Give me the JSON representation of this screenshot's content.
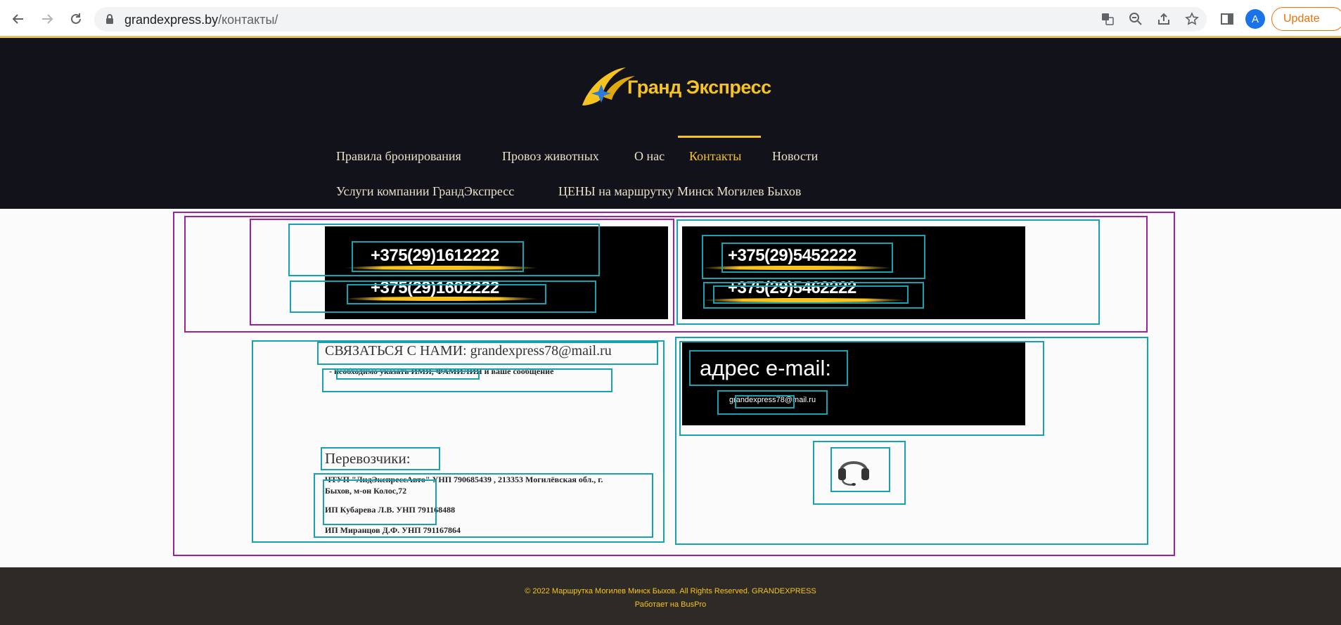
{
  "browser": {
    "url_domain": "grandexpress.by",
    "url_path": "/контакты/",
    "profile_initial": "A",
    "update_label": "Update"
  },
  "site": {
    "logo_text": "Гранд Экспресс",
    "nav": [
      {
        "label": "Правила бронирования"
      },
      {
        "label": "Провоз животных"
      },
      {
        "label": "О нас"
      },
      {
        "label": "Контакты"
      },
      {
        "label": "Новости"
      },
      {
        "label": "Услуги компании ГрандЭкспресс"
      },
      {
        "label": "ЦЕНЫ на маршрутку Минск Могилев Быхов"
      }
    ]
  },
  "phones": {
    "left": [
      "+375(29)1612222",
      "+375(29)1602222"
    ],
    "right": [
      "+375(29)5452222",
      "+375(29)5462222"
    ]
  },
  "contact": {
    "heading": "СВЯЗАТЬСЯ С НАМИ: grandexpress78@mail.ru",
    "note": "- необходимо указать ИМЯ, ФАМИЛИЯ и ваше сообщение",
    "carriers_title": "Перевозчики:",
    "carriers": [
      "ЧТУП \"ЛидЭкспрессАвто\" УНП 790685439 , 213353 Могилёвская обл., г.",
      "Быхов, м-он Колос,72",
      "ИП Кубарева Л.В. УНП 791168488",
      "ИП Миранцов Д.Ф. УНП 791167864"
    ]
  },
  "email_box": {
    "title": "адрес e-mail:",
    "address": "grandexpress78@mail.ru",
    "support_icon": "headset-icon"
  },
  "footer": {
    "copyright": "© 2022 Маршрутка Могилев Минск Быхов. All Rights Reserved. GRANDEXPRESS",
    "powered": "Работает на BusPro"
  }
}
